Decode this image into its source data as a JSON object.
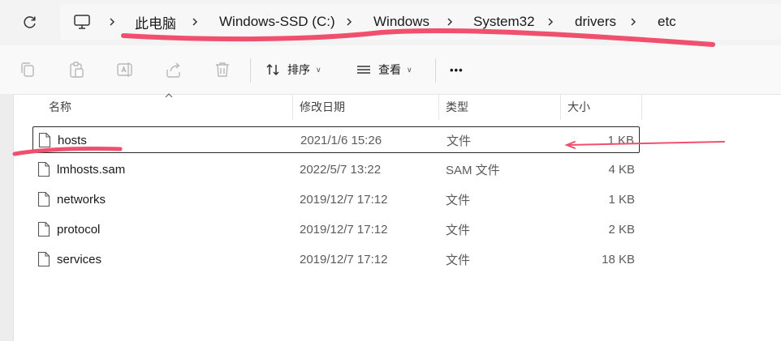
{
  "address": {
    "parts": [
      "此电脑",
      "Windows-SSD (C:)",
      "Windows",
      "System32",
      "drivers",
      "etc"
    ]
  },
  "toolbar": {
    "sort_label": "排序",
    "view_label": "查看",
    "more_label": "•••"
  },
  "columns": {
    "name": "名称",
    "date": "修改日期",
    "type": "类型",
    "size": "大小"
  },
  "files": [
    {
      "name": "hosts",
      "date": "2021/1/6 15:26",
      "type": "文件",
      "size": "1 KB",
      "selected": true
    },
    {
      "name": "lmhosts.sam",
      "date": "2022/5/7 13:22",
      "type": "SAM 文件",
      "size": "4 KB"
    },
    {
      "name": "networks",
      "date": "2019/12/7 17:12",
      "type": "文件",
      "size": "1 KB"
    },
    {
      "name": "protocol",
      "date": "2019/12/7 17:12",
      "type": "文件",
      "size": "2 KB"
    },
    {
      "name": "services",
      "date": "2019/12/7 17:12",
      "type": "文件",
      "size": "18 KB"
    }
  ],
  "colors": {
    "annotation": "#f0506e",
    "selection_border": "#2b2b2b",
    "toolbar_icon_disabled": "#b8b8b8"
  }
}
